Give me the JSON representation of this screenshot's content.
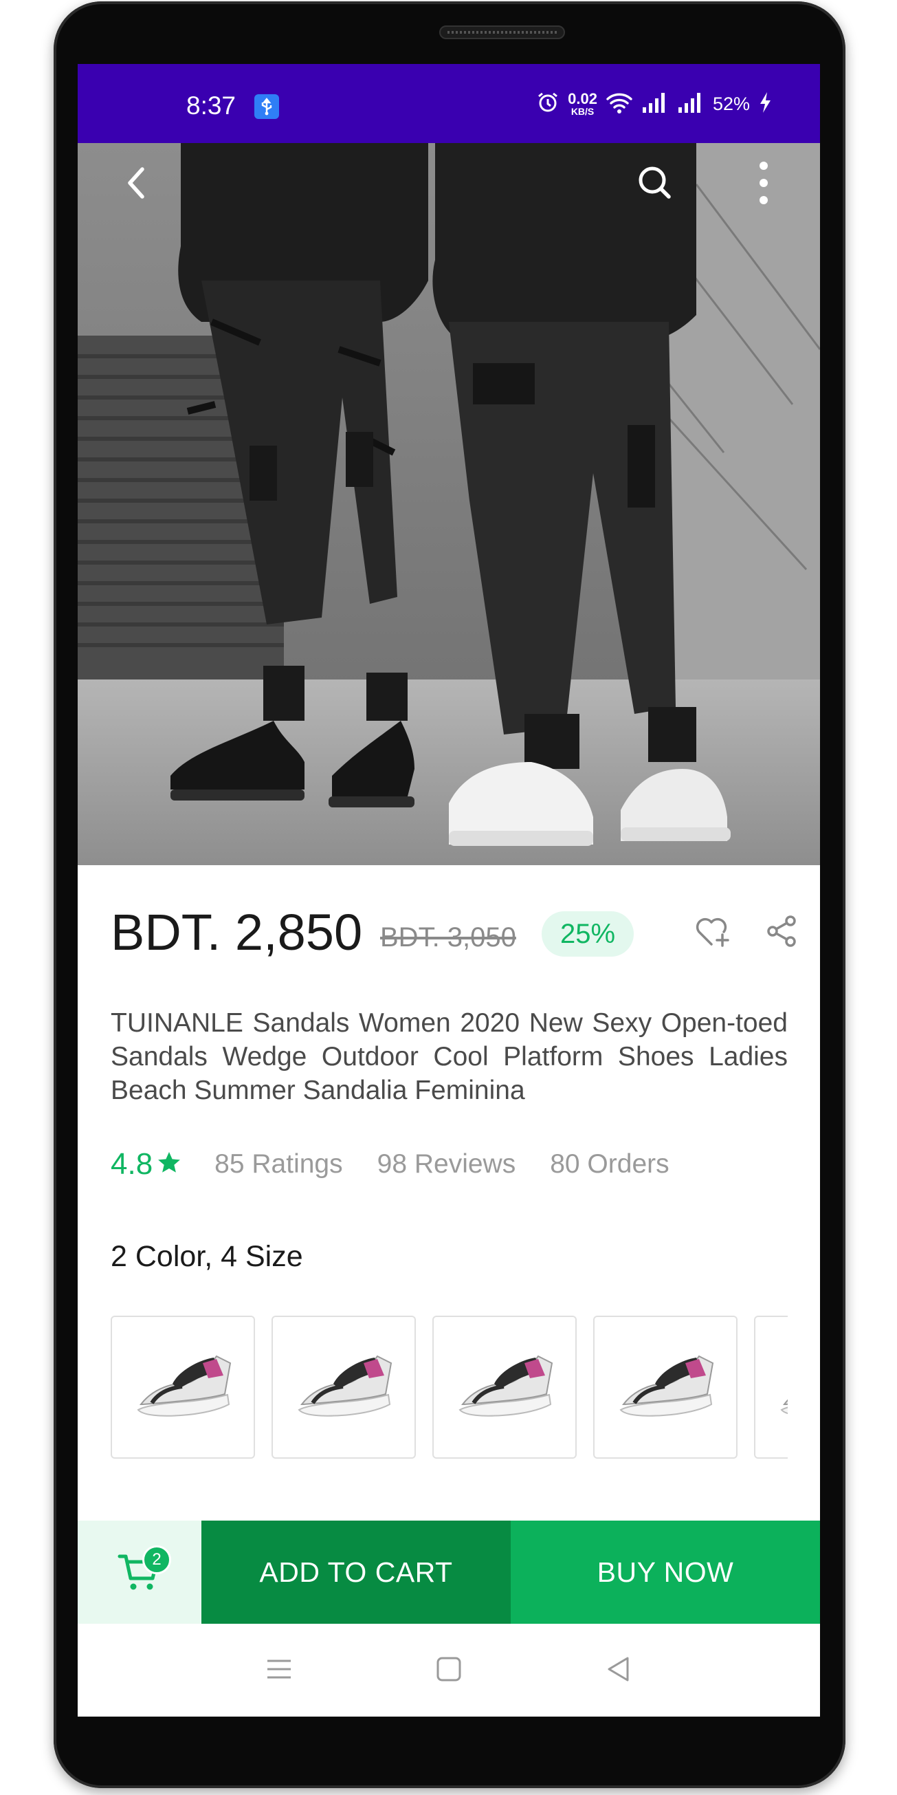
{
  "status_bar": {
    "time": "8:37",
    "net_speed_value": "0.02",
    "net_speed_unit": "KB/S",
    "battery": "52%",
    "icons": [
      "usb-icon",
      "alarm-icon",
      "wifi-icon",
      "signal-icon",
      "signal-icon",
      "charging-icon"
    ]
  },
  "hero": {
    "icons": {
      "back": "chevron-left-icon",
      "search": "search-icon",
      "more": "more-vertical-icon"
    }
  },
  "product": {
    "price": "BDT. 2,850",
    "old_price": "BDT. 3,050",
    "discount": "25%",
    "title": "TUINANLE Sandals Women 2020 New Sexy Open-toed Sandals Wedge Outdoor Cool Platform Shoes Ladies Beach Summer Sandalia Feminina",
    "rating": "4.8",
    "ratings_count": "85 Ratings",
    "reviews_count": "98 Reviews",
    "orders_count": "80 Orders",
    "variants_label": "2 Color, 4 Size"
  },
  "actions": {
    "cart_badge": "2",
    "add_to_cart": "ADD TO CART",
    "buy_now": "BUY NOW"
  },
  "colors": {
    "status_bar": "#3a00b0",
    "accent_green": "#10b662",
    "add_to_cart_bg": "#078b42",
    "buy_now_bg": "#0cb15b"
  }
}
